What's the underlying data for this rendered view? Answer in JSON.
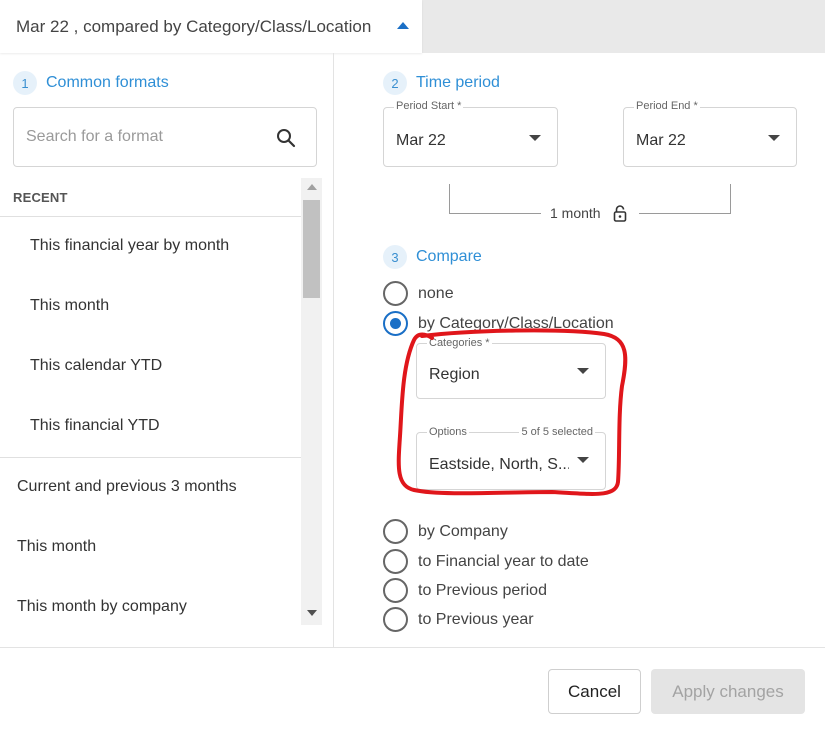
{
  "header": {
    "title": "Mar 22 , compared by Category/Class/Location"
  },
  "common_formats": {
    "step_number": "1",
    "step_label": "Common formats",
    "search_placeholder": "Search for a format",
    "recent_heading": "RECENT",
    "recent_items": [
      "This financial year by month",
      "This month",
      "This calendar YTD",
      "This financial YTD"
    ],
    "other_items": [
      "Current and previous 3 months",
      "This month",
      "This month by company"
    ]
  },
  "time_period": {
    "step_number": "2",
    "step_label": "Time period",
    "start_label": "Period Start *",
    "start_value": "Mar 22",
    "end_label": "Period End *",
    "end_value": "Mar 22",
    "duration": "1 month"
  },
  "compare": {
    "step_number": "3",
    "step_label": "Compare",
    "options": [
      {
        "label": "none",
        "selected": false
      },
      {
        "label": "by Category/Class/Location",
        "selected": true
      },
      {
        "label": "by Company",
        "selected": false
      },
      {
        "label": "to Financial year to date",
        "selected": false
      },
      {
        "label": "to Previous period",
        "selected": false
      },
      {
        "label": "to Previous year",
        "selected": false
      }
    ],
    "categories_label": "Categories *",
    "categories_value": "Region",
    "options_label": "Options",
    "options_count": "5 of 5 selected",
    "options_value": "Eastside, North, S..."
  },
  "footer": {
    "cancel_label": "Cancel",
    "apply_label": "Apply changes"
  },
  "colors": {
    "accent": "#2f8fd6",
    "radio_selected": "#1a6fc6",
    "annotation": "#e0161b"
  }
}
